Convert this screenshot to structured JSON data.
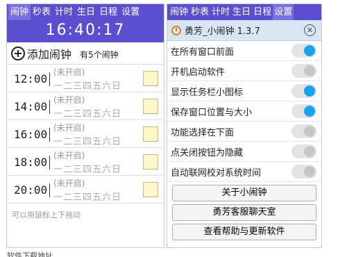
{
  "left": {
    "tabs": [
      "闹钟",
      "秒表",
      "计时",
      "生日",
      "日程",
      "设置"
    ],
    "clock": "16:40:17",
    "add_label": "添加闹钟",
    "count_label": "有5个闹钟",
    "alarms": [
      {
        "time": "12:00",
        "status": "(未开启)",
        "days": "一二三四五六日"
      },
      {
        "time": "14:00",
        "status": "(未开启)",
        "days": "一二三四五六日"
      },
      {
        "time": "16:00",
        "status": "(未开启)",
        "days": "一二三四五六日"
      },
      {
        "time": "18:00",
        "status": "(未开启)",
        "days": "一二三四五六日"
      },
      {
        "time": "20:00",
        "status": "(未开启)",
        "days": "一二三四五六日"
      }
    ],
    "hint": "可以用鼠标上下拖动"
  },
  "right": {
    "tabs": [
      "闹钟",
      "秒表",
      "计时",
      "生日",
      "日程",
      "设置"
    ],
    "title": "勇芳_小闹钟 1.3.7",
    "close_symbol": "✕",
    "settings": [
      {
        "label": "在所有窗口前面",
        "on": true
      },
      {
        "label": "开机启动软件",
        "on": false
      },
      {
        "label": "显示任务栏小图标",
        "on": true
      },
      {
        "label": "保存窗口位置与大小",
        "on": true
      },
      {
        "label": "功能选择在下面",
        "on": false
      },
      {
        "label": "点关闭按钮为隐藏",
        "on": false
      },
      {
        "label": "自动联网校对系统时间",
        "on": false
      }
    ],
    "buttons": [
      "关于小闹钟",
      "勇芳客服聊天室",
      "查看帮助与更新软件"
    ]
  },
  "footer": "软件下载地址",
  "colors": {
    "tabbar": "#5b4fd0",
    "toggle_on": "#1ba1f0",
    "toggle_off": "#c6c6c6",
    "titlebar": "#d8e6f2"
  }
}
